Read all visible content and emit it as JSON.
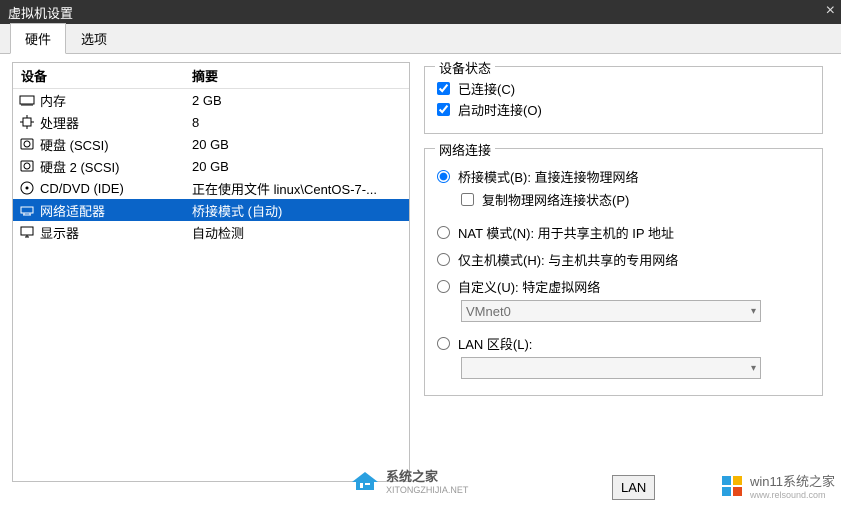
{
  "window": {
    "title": "虚拟机设置"
  },
  "tabs": {
    "hardware": "硬件",
    "options": "选项"
  },
  "list": {
    "header_device": "设备",
    "header_summary": "摘要",
    "rows": [
      {
        "icon": "memory",
        "name": "内存",
        "summary": "2 GB"
      },
      {
        "icon": "cpu",
        "name": "处理器",
        "summary": "8"
      },
      {
        "icon": "hdd",
        "name": "硬盘 (SCSI)",
        "summary": "20 GB"
      },
      {
        "icon": "hdd",
        "name": "硬盘 2 (SCSI)",
        "summary": "20 GB"
      },
      {
        "icon": "cd",
        "name": "CD/DVD (IDE)",
        "summary": "正在使用文件 linux\\CentOS-7-..."
      },
      {
        "icon": "net",
        "name": "网络适配器",
        "summary": "桥接模式 (自动)"
      },
      {
        "icon": "display",
        "name": "显示器",
        "summary": "自动检测"
      }
    ],
    "selected_index": 5
  },
  "right": {
    "device_status": {
      "legend": "设备状态",
      "connected_label": "已连接(C)",
      "connect_at_start_label": "启动时连接(O)"
    },
    "network": {
      "legend": "网络连接",
      "bridged_label": "桥接模式(B): 直接连接物理网络",
      "replicate_label": "复制物理网络连接状态(P)",
      "nat_label": "NAT 模式(N): 用于共享主机的 IP 地址",
      "hostonly_label": "仅主机模式(H): 与主机共享的专用网络",
      "custom_label": "自定义(U): 特定虚拟网络",
      "custom_value": "VMnet0",
      "lan_label": "LAN 区段(L):",
      "lan_value": ""
    }
  },
  "lan_button": "LAN",
  "watermark1": {
    "name": "系统之家",
    "url": "XITONGZHIJIA.NET"
  },
  "watermark2": {
    "name": "win11系统之家",
    "url": "www.relsound.com"
  }
}
